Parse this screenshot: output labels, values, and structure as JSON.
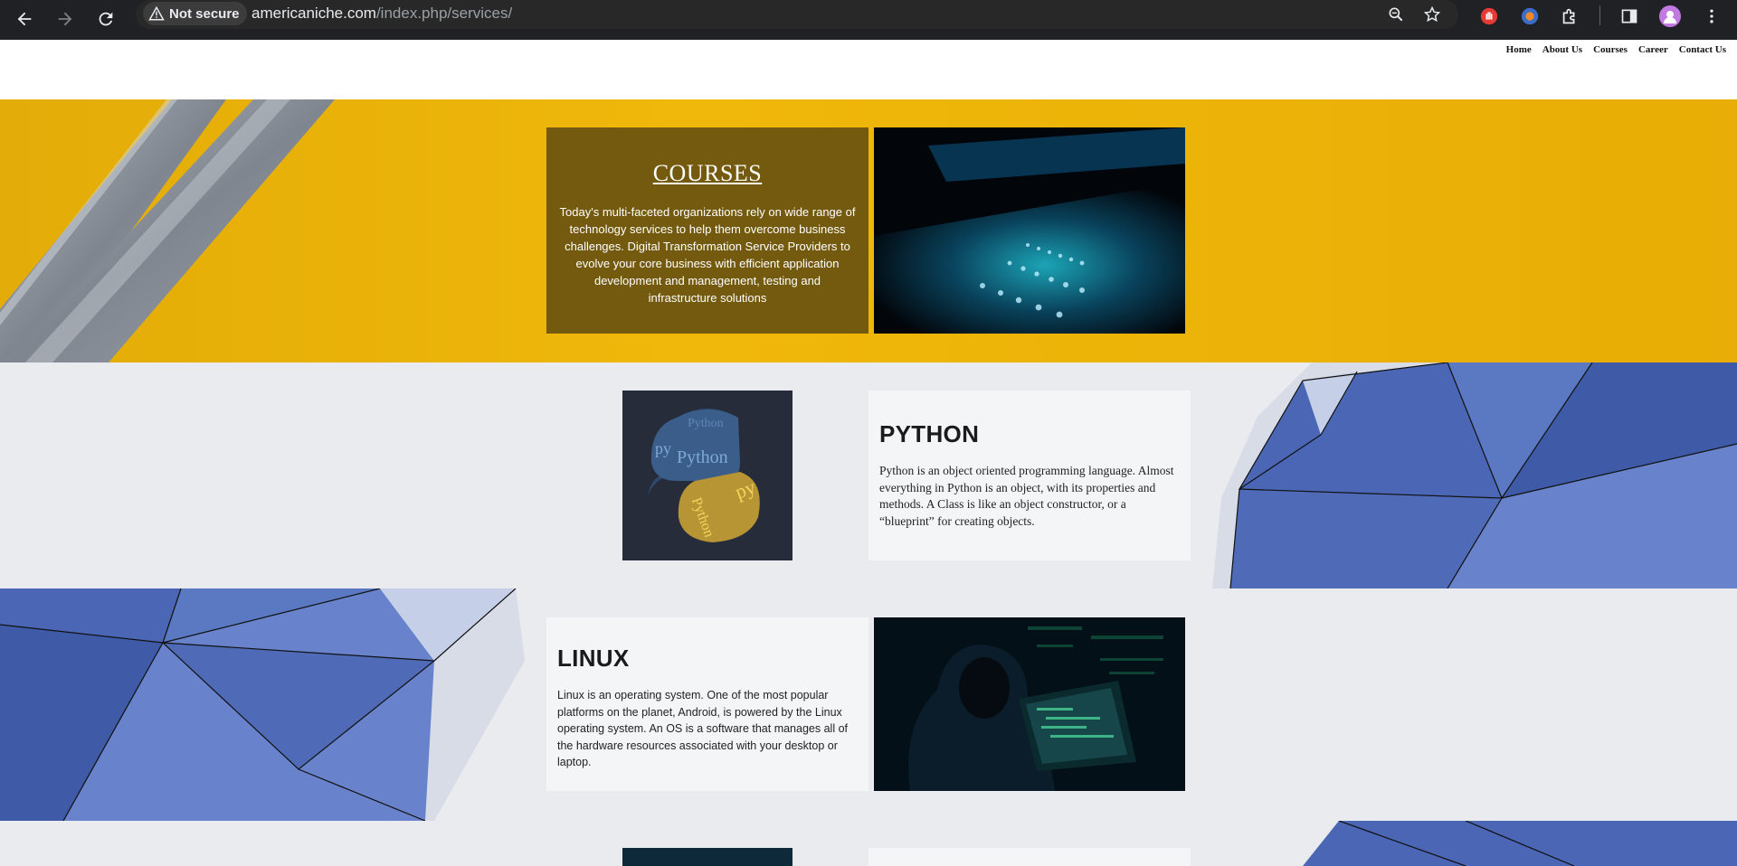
{
  "browser": {
    "security_label": "Not secure",
    "url_host": "americaniche.com",
    "url_path": "/index.php/services/"
  },
  "site_nav": {
    "items": [
      "Home",
      "About Us",
      "Courses",
      "Career",
      "Contact Us"
    ]
  },
  "courses": {
    "title": "COURSES",
    "text": "Today's multi-faceted organizations rely on wide range of technology services to help them overcome business challenges. Digital Transformation Service Providers to evolve your core business with efficient application development and management, testing and infrastructure solutions"
  },
  "python": {
    "title": "PYTHON",
    "text": "Python is an object oriented programming language. Almost everything in Python is an object, with its properties and methods. A Class is like an object constructor, or a “blueprint” for creating objects.",
    "logo_words": [
      "Python",
      "py",
      "Python",
      "py",
      "Python"
    ]
  },
  "linux": {
    "title": "LINUX",
    "text": "Linux is an operating system. One of the most popular platforms on the planet, Android, is powered by the Linux operating system. An OS is a software that manages all of the hardware resources associated with your desktop or laptop."
  },
  "colors": {
    "courses_bg": "#f0b80a",
    "courses_box": "#735a0e",
    "geo_blue": "#4663b3",
    "page_bg": "#e9ebef",
    "chrome_bg": "#202124"
  }
}
